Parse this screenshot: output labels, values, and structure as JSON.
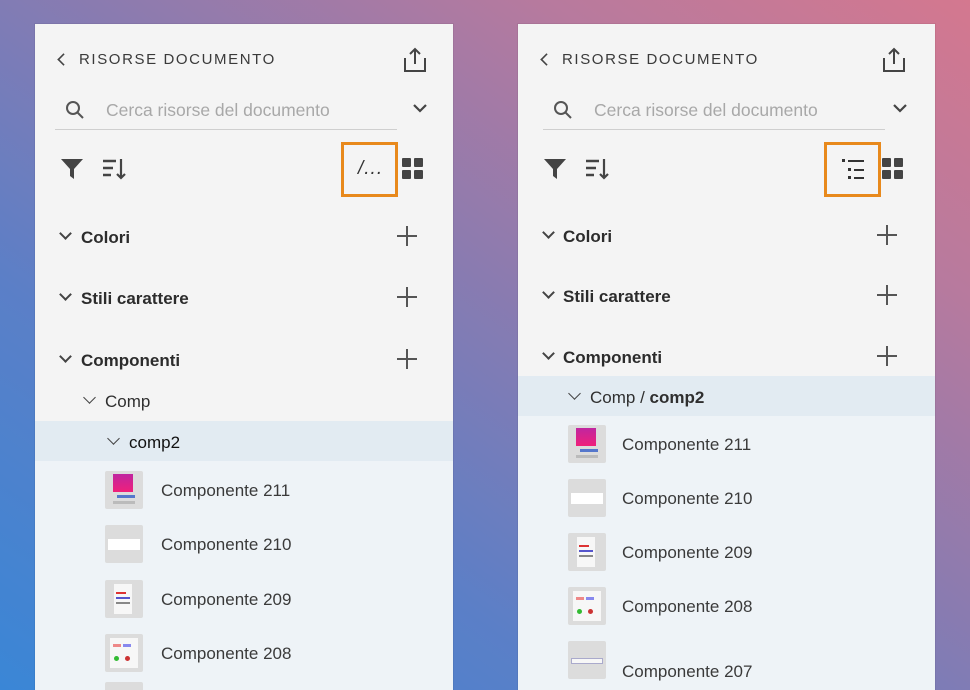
{
  "panels": {
    "left": {
      "title": "RISORSE DOCUMENTO",
      "search_placeholder": "Cerca risorse del documento",
      "path_toggle_label": "/...",
      "sections": {
        "colors": "Colori",
        "char_styles": "Stili carattere",
        "components": "Componenti"
      },
      "group": "Comp",
      "subgroup": "comp2",
      "items": [
        "Componente 211",
        "Componente 210",
        "Componente 209",
        "Componente 208"
      ]
    },
    "right": {
      "title": "RISORSE DOCUMENTO",
      "search_placeholder": "Cerca risorse del documento",
      "sections": {
        "colors": "Colori",
        "char_styles": "Stili carattere",
        "components": "Componenti"
      },
      "group_path": "Comp / ",
      "group_leaf": "comp2",
      "items": [
        "Componente 211",
        "Componente 210",
        "Componente 209",
        "Componente 208",
        "Componente 207"
      ]
    }
  },
  "colors": {
    "highlight": "#e8891c",
    "selected_band": "#e2ebf2",
    "panel_bg": "#f4f4f4"
  },
  "icons": [
    "back-chevron-icon",
    "share-icon",
    "search-icon",
    "chevron-down-icon",
    "filter-icon",
    "sort-icon",
    "path-view-icon",
    "tree-view-icon",
    "grid-view-icon",
    "plus-icon"
  ]
}
